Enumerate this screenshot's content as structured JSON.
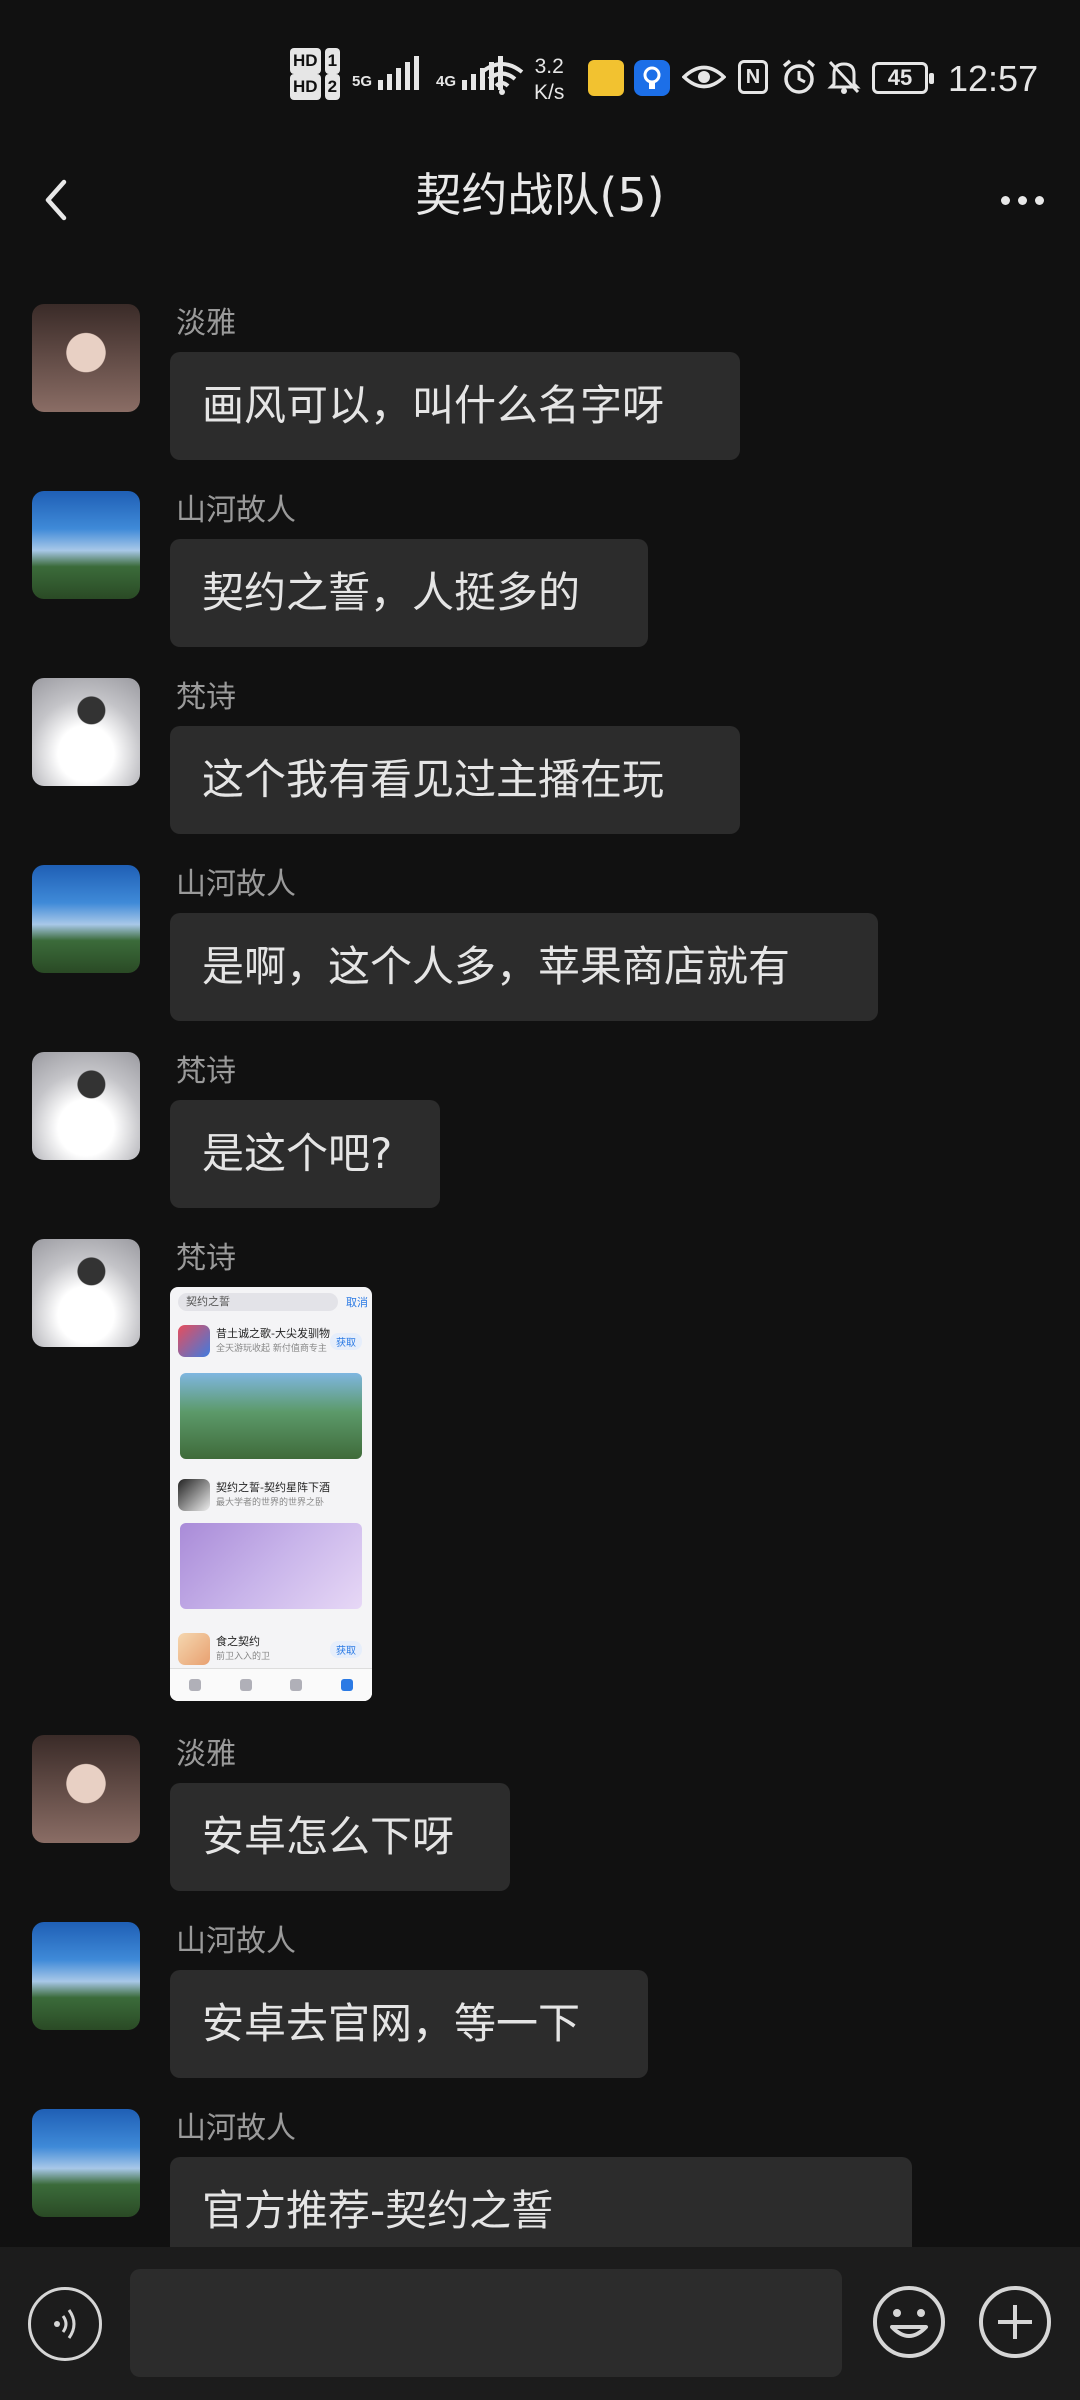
{
  "status_bar": {
    "hd1": "HD",
    "hd1_num": "1",
    "hd2": "HD",
    "hd2_num": "2",
    "net1": "5G",
    "net2": "4G",
    "speed_value": "3.2",
    "speed_unit": "K/s",
    "battery": "45",
    "time": "12:57",
    "icons": [
      "wifi-icon",
      "app-notify-icon",
      "bulb-icon",
      "eye-icon",
      "nfc-icon",
      "alarm-icon",
      "mute-icon"
    ]
  },
  "header": {
    "title": "契约战队(5)"
  },
  "messages": [
    {
      "name": "淡雅",
      "text": "画风可以，叫什么名字呀",
      "avatar": "avatar-girl"
    },
    {
      "name": "山河故人",
      "text": "契约之誓，人挺多的",
      "avatar": "avatar-sky"
    },
    {
      "name": "梵诗",
      "text": "这个我有看见过主播在玩",
      "avatar": "avatar-fog"
    },
    {
      "name": "山河故人",
      "text": "是啊，这个人多，苹果商店就有",
      "avatar": "avatar-sky"
    },
    {
      "name": "梵诗",
      "text": "是这个吧?",
      "avatar": "avatar-fog"
    },
    {
      "name": "梵诗",
      "image": {
        "search_text": "契约之誓",
        "cancel": "取消",
        "app1_title": "昔土诚之歌-大尖发驯物",
        "app1_sub": "全天游玩收起 新付值商专主",
        "app1_get": "获取",
        "app2_title": "契约之誓-契约星阵下酒",
        "app2_sub": "最大学者的世界的世界之卧",
        "app3_title": "食之契约",
        "app3_sub": "前卫入入的卫",
        "app3_get": "获取"
      },
      "avatar": "avatar-fog"
    },
    {
      "name": "淡雅",
      "text": "安卓怎么下呀",
      "avatar": "avatar-girl"
    },
    {
      "name": "山河故人",
      "text": "安卓去官网，等一下",
      "avatar": "avatar-sky"
    },
    {
      "name": "山河故人",
      "text": "官方推荐-契约之誓",
      "avatar": "avatar-sky"
    }
  ],
  "input": {
    "placeholder": ""
  },
  "colors": {
    "background": "#111111",
    "bubble": "#2c2c2c",
    "bottom_bar": "#1c1c1c",
    "name_text": "#9a9a9a",
    "bubble_text": "#e5e5e5"
  }
}
